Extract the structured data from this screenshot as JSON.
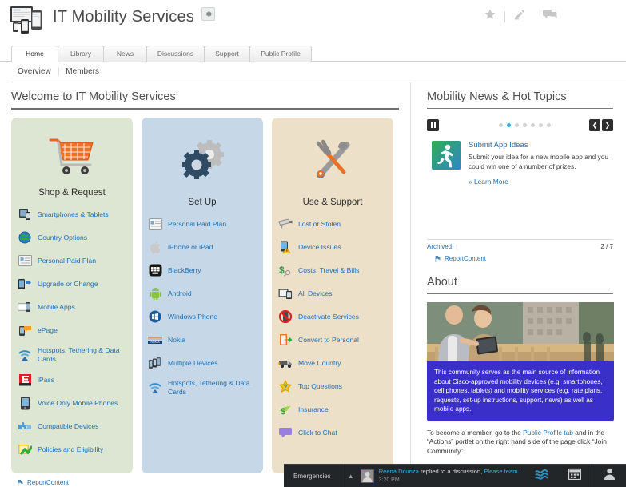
{
  "header": {
    "title": "IT Mobility Services",
    "logo_icon": "devices-logo-icon",
    "gear_icon": "gear-icon",
    "actions": [
      {
        "icon": "star-icon",
        "name": "favorite-button"
      },
      {
        "icon": "edit-icon",
        "name": "edit-button"
      },
      {
        "icon": "chat-bubble-icon",
        "name": "chat-button"
      }
    ]
  },
  "tabs": [
    {
      "label": "Home",
      "active": true
    },
    {
      "label": "Library",
      "active": false
    },
    {
      "label": "News",
      "active": false
    },
    {
      "label": "Discussions",
      "active": false
    },
    {
      "label": "Support",
      "active": false
    },
    {
      "label": "Public Profile",
      "active": false
    }
  ],
  "subnav": {
    "overview": "Overview",
    "separator": "|",
    "members": "Members"
  },
  "main": {
    "welcome_title": "Welcome to IT Mobility Services",
    "panels": [
      {
        "heading": "Shop & Request",
        "hero_icon": "shopping-cart-icon",
        "accent": "#dde6d2",
        "links": [
          {
            "label": "Smartphones & Tablets",
            "icon": "smartphone-tablet-icon"
          },
          {
            "label": "Country Options",
            "icon": "globe-icon"
          },
          {
            "label": "Personal Paid Plan",
            "icon": "id-card-icon"
          },
          {
            "label": "Upgrade or Change",
            "icon": "upgrade-phone-icon"
          },
          {
            "label": "Mobile Apps",
            "icon": "mobile-apps-icon"
          },
          {
            "label": "ePage",
            "icon": "epage-icon"
          },
          {
            "label": "Hotspots, Tethering & Data Cards",
            "icon": "wifi-hotspot-icon"
          },
          {
            "label": "iPass",
            "icon": "ipass-icon"
          },
          {
            "label": "Voice Only Mobile Phones",
            "icon": "voice-phone-icon"
          },
          {
            "label": "Compatible Devices",
            "icon": "puzzle-icon"
          },
          {
            "label": "Policies and Eligibility",
            "icon": "checklist-icon"
          }
        ]
      },
      {
        "heading": "Set Up",
        "hero_icon": "gears-icon",
        "accent": "#c6d8e8",
        "links": [
          {
            "label": "Personal Paid Plan",
            "icon": "id-card-icon"
          },
          {
            "label": "iPhone or iPad",
            "icon": "apple-icon"
          },
          {
            "label": "BlackBerry",
            "icon": "blackberry-icon"
          },
          {
            "label": "Android",
            "icon": "android-icon"
          },
          {
            "label": "Windows Phone",
            "icon": "windows-icon"
          },
          {
            "label": "Nokia",
            "icon": "nokia-icon"
          },
          {
            "label": "Multiple Devices",
            "icon": "multiple-devices-icon"
          },
          {
            "label": "Hotspots, Tethering & Data Cards",
            "icon": "wifi-hotspot-icon"
          }
        ]
      },
      {
        "heading": "Use & Support",
        "hero_icon": "tools-icon",
        "accent": "#ece0c9",
        "links": [
          {
            "label": "Lost or Stolen",
            "icon": "security-camera-icon"
          },
          {
            "label": "Device Issues",
            "icon": "device-warning-icon"
          },
          {
            "label": "Costs, Travel & Bills",
            "icon": "dollar-icon"
          },
          {
            "label": "All Devices",
            "icon": "all-devices-icon"
          },
          {
            "label": "Deactivate Services",
            "icon": "no-phone-icon"
          },
          {
            "label": "Convert to Personal",
            "icon": "door-exit-icon"
          },
          {
            "label": "Move Country",
            "icon": "moving-truck-icon"
          },
          {
            "label": "Top Questions",
            "icon": "star-question-icon"
          },
          {
            "label": "Insurance",
            "icon": "insurance-icon"
          },
          {
            "label": "Click to Chat",
            "icon": "chat-bubble-icon"
          }
        ]
      }
    ],
    "report_content": "ReportContent"
  },
  "news": {
    "title": "Mobility News & Hot Topics",
    "pause_icon": "pause-icon",
    "prev_icon": "chevron-left-icon",
    "next_icon": "chevron-right-icon",
    "dots_total": 7,
    "dots_active_index": 1,
    "item": {
      "thumb_icon": "running-person-icon",
      "title": "Submit App Ideas",
      "description": "Submit your idea for a new mobile app and you could win one of a number of prizes.",
      "learn_more": "» Learn More"
    },
    "footer": {
      "archived": "Archived",
      "separator": "|",
      "count": "2 / 7",
      "report_content": "ReportContent"
    }
  },
  "about": {
    "title": "About",
    "photo_alt": "two-colleagues-with-tablet-photo",
    "overlay_text": "This community serves as the main source of information about Cisco-approved mobility devices (e.g. smartphones, cell phones, tablets) and mobility services (e.g. rate plans, requests, set-up instructions, support, news) as well as mobile apps.",
    "note_prefix": "To become a member, go to the ",
    "note_link": "Public Profile tab",
    "note_suffix": " and in the “Actions” portlet on the right hand side of the page click “Join Community”."
  },
  "chatbar": {
    "emergencies": "Emergencies",
    "caret_icon": "chevron-up-icon",
    "avatar_icon": "user-avatar-icon",
    "message_author": "Reena Dcunza",
    "message_action": " replied to a discussion, ",
    "message_topic": "Please team…",
    "message_time": "3:20 PM",
    "icons": [
      {
        "name": "streams-icon",
        "glyph": "≋"
      },
      {
        "name": "calendar-icon",
        "glyph": "▦"
      },
      {
        "name": "contacts-icon",
        "glyph": "♟"
      }
    ]
  },
  "colors": {
    "link": "#1f6fb4",
    "panel_shop": "#dde6d2",
    "panel_setup": "#c6d8e8",
    "panel_use": "#ece0c9",
    "accent_blue": "#2fb0e8",
    "about_overlay": "#3b2fc9",
    "chatbar_bg": "#232628"
  }
}
